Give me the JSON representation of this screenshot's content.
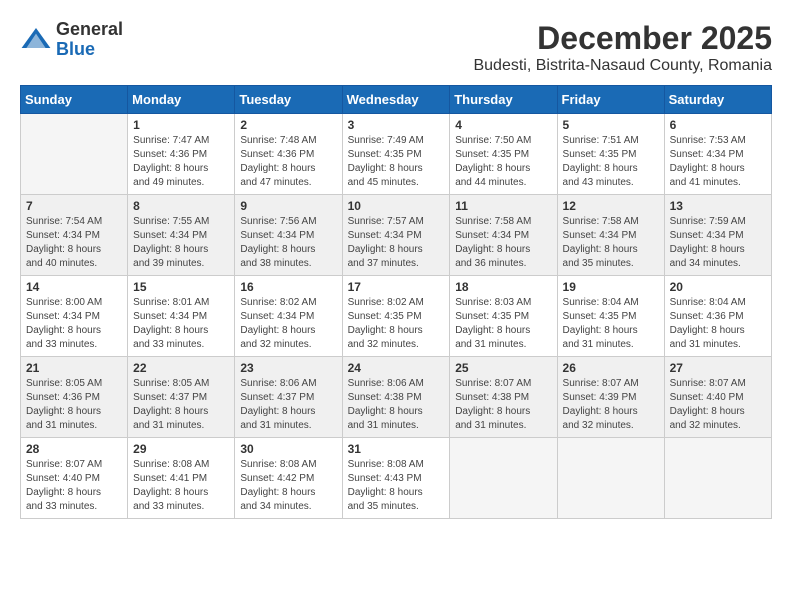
{
  "header": {
    "logo_line1": "General",
    "logo_line2": "Blue",
    "month": "December 2025",
    "location": "Budesti, Bistrita-Nasaud County, Romania"
  },
  "days_of_week": [
    "Sunday",
    "Monday",
    "Tuesday",
    "Wednesday",
    "Thursday",
    "Friday",
    "Saturday"
  ],
  "weeks": [
    [
      {
        "day": "",
        "info": ""
      },
      {
        "day": "1",
        "info": "Sunrise: 7:47 AM\nSunset: 4:36 PM\nDaylight: 8 hours\nand 49 minutes."
      },
      {
        "day": "2",
        "info": "Sunrise: 7:48 AM\nSunset: 4:36 PM\nDaylight: 8 hours\nand 47 minutes."
      },
      {
        "day": "3",
        "info": "Sunrise: 7:49 AM\nSunset: 4:35 PM\nDaylight: 8 hours\nand 45 minutes."
      },
      {
        "day": "4",
        "info": "Sunrise: 7:50 AM\nSunset: 4:35 PM\nDaylight: 8 hours\nand 44 minutes."
      },
      {
        "day": "5",
        "info": "Sunrise: 7:51 AM\nSunset: 4:35 PM\nDaylight: 8 hours\nand 43 minutes."
      },
      {
        "day": "6",
        "info": "Sunrise: 7:53 AM\nSunset: 4:34 PM\nDaylight: 8 hours\nand 41 minutes."
      }
    ],
    [
      {
        "day": "7",
        "info": "Sunrise: 7:54 AM\nSunset: 4:34 PM\nDaylight: 8 hours\nand 40 minutes."
      },
      {
        "day": "8",
        "info": "Sunrise: 7:55 AM\nSunset: 4:34 PM\nDaylight: 8 hours\nand 39 minutes."
      },
      {
        "day": "9",
        "info": "Sunrise: 7:56 AM\nSunset: 4:34 PM\nDaylight: 8 hours\nand 38 minutes."
      },
      {
        "day": "10",
        "info": "Sunrise: 7:57 AM\nSunset: 4:34 PM\nDaylight: 8 hours\nand 37 minutes."
      },
      {
        "day": "11",
        "info": "Sunrise: 7:58 AM\nSunset: 4:34 PM\nDaylight: 8 hours\nand 36 minutes."
      },
      {
        "day": "12",
        "info": "Sunrise: 7:58 AM\nSunset: 4:34 PM\nDaylight: 8 hours\nand 35 minutes."
      },
      {
        "day": "13",
        "info": "Sunrise: 7:59 AM\nSunset: 4:34 PM\nDaylight: 8 hours\nand 34 minutes."
      }
    ],
    [
      {
        "day": "14",
        "info": "Sunrise: 8:00 AM\nSunset: 4:34 PM\nDaylight: 8 hours\nand 33 minutes."
      },
      {
        "day": "15",
        "info": "Sunrise: 8:01 AM\nSunset: 4:34 PM\nDaylight: 8 hours\nand 33 minutes."
      },
      {
        "day": "16",
        "info": "Sunrise: 8:02 AM\nSunset: 4:34 PM\nDaylight: 8 hours\nand 32 minutes."
      },
      {
        "day": "17",
        "info": "Sunrise: 8:02 AM\nSunset: 4:35 PM\nDaylight: 8 hours\nand 32 minutes."
      },
      {
        "day": "18",
        "info": "Sunrise: 8:03 AM\nSunset: 4:35 PM\nDaylight: 8 hours\nand 31 minutes."
      },
      {
        "day": "19",
        "info": "Sunrise: 8:04 AM\nSunset: 4:35 PM\nDaylight: 8 hours\nand 31 minutes."
      },
      {
        "day": "20",
        "info": "Sunrise: 8:04 AM\nSunset: 4:36 PM\nDaylight: 8 hours\nand 31 minutes."
      }
    ],
    [
      {
        "day": "21",
        "info": "Sunrise: 8:05 AM\nSunset: 4:36 PM\nDaylight: 8 hours\nand 31 minutes."
      },
      {
        "day": "22",
        "info": "Sunrise: 8:05 AM\nSunset: 4:37 PM\nDaylight: 8 hours\nand 31 minutes."
      },
      {
        "day": "23",
        "info": "Sunrise: 8:06 AM\nSunset: 4:37 PM\nDaylight: 8 hours\nand 31 minutes."
      },
      {
        "day": "24",
        "info": "Sunrise: 8:06 AM\nSunset: 4:38 PM\nDaylight: 8 hours\nand 31 minutes."
      },
      {
        "day": "25",
        "info": "Sunrise: 8:07 AM\nSunset: 4:38 PM\nDaylight: 8 hours\nand 31 minutes."
      },
      {
        "day": "26",
        "info": "Sunrise: 8:07 AM\nSunset: 4:39 PM\nDaylight: 8 hours\nand 32 minutes."
      },
      {
        "day": "27",
        "info": "Sunrise: 8:07 AM\nSunset: 4:40 PM\nDaylight: 8 hours\nand 32 minutes."
      }
    ],
    [
      {
        "day": "28",
        "info": "Sunrise: 8:07 AM\nSunset: 4:40 PM\nDaylight: 8 hours\nand 33 minutes."
      },
      {
        "day": "29",
        "info": "Sunrise: 8:08 AM\nSunset: 4:41 PM\nDaylight: 8 hours\nand 33 minutes."
      },
      {
        "day": "30",
        "info": "Sunrise: 8:08 AM\nSunset: 4:42 PM\nDaylight: 8 hours\nand 34 minutes."
      },
      {
        "day": "31",
        "info": "Sunrise: 8:08 AM\nSunset: 4:43 PM\nDaylight: 8 hours\nand 35 minutes."
      },
      {
        "day": "",
        "info": ""
      },
      {
        "day": "",
        "info": ""
      },
      {
        "day": "",
        "info": ""
      }
    ]
  ]
}
